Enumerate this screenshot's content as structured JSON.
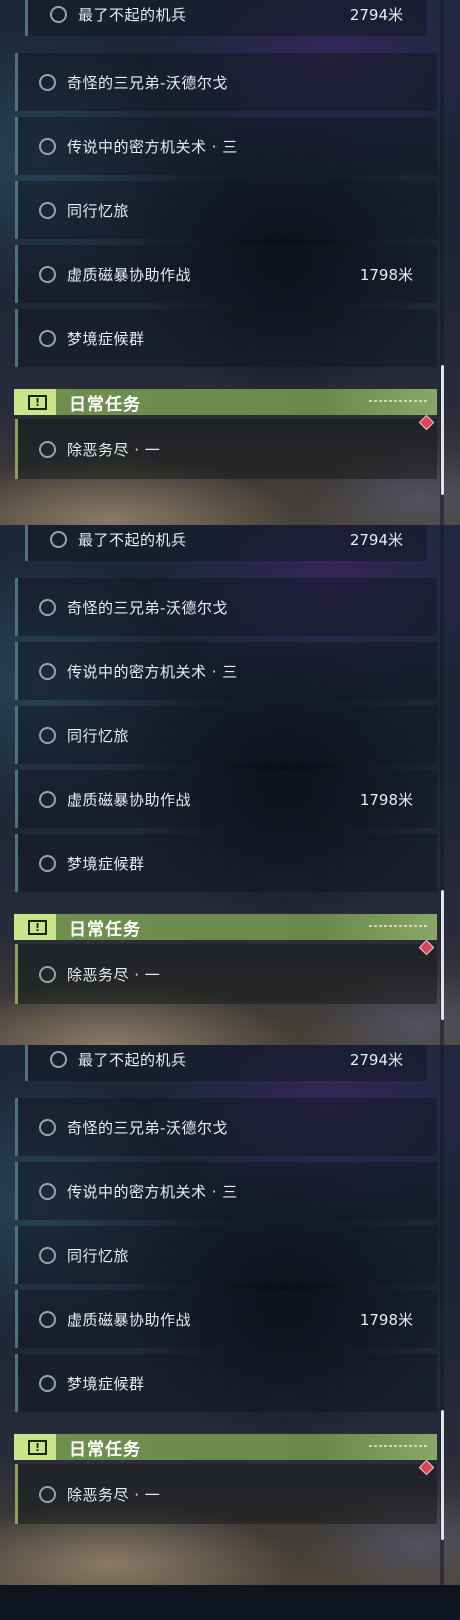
{
  "panels": [
    {
      "quests": [
        {
          "name": "最了不起的机兵",
          "distance": "2794米"
        },
        {
          "name": "奇怪的三兄弟-沃德尔戈",
          "distance": ""
        },
        {
          "name": "传说中的密方机关术 · 三",
          "distance": ""
        },
        {
          "name": "同行忆旅",
          "distance": ""
        },
        {
          "name": "虚质磁暴协助作战",
          "distance": "1798米"
        },
        {
          "name": "梦境症候群",
          "distance": ""
        }
      ],
      "section_title": "日常任务",
      "daily_quest": "除恶务尽 · 一"
    },
    {
      "quests": [
        {
          "name": "最了不起的机兵",
          "distance": "2794米"
        },
        {
          "name": "奇怪的三兄弟-沃德尔戈",
          "distance": ""
        },
        {
          "name": "传说中的密方机关术 · 三",
          "distance": ""
        },
        {
          "name": "同行忆旅",
          "distance": ""
        },
        {
          "name": "虚质磁暴协助作战",
          "distance": "1798米"
        },
        {
          "name": "梦境症候群",
          "distance": ""
        }
      ],
      "section_title": "日常任务",
      "daily_quest": "除恶务尽 · 一"
    },
    {
      "quests": [
        {
          "name": "最了不起的机兵",
          "distance": "2794米"
        },
        {
          "name": "奇怪的三兄弟-沃德尔戈",
          "distance": ""
        },
        {
          "name": "传说中的密方机关术 · 三",
          "distance": ""
        },
        {
          "name": "同行忆旅",
          "distance": ""
        },
        {
          "name": "虚质磁暴协助作战",
          "distance": "1798米"
        },
        {
          "name": "梦境症候群",
          "distance": ""
        }
      ],
      "section_title": "日常任务",
      "daily_quest": "除恶务尽 · 一"
    }
  ],
  "icons": {
    "quest_status": "radio-circle-icon",
    "section": "exclamation-icon",
    "tracking": "diamond-marker-icon"
  },
  "colors": {
    "section_accent": "#c9e58a",
    "section_bar": "#6b8a4c",
    "quest_border": "#4e7284",
    "daily_border": "#8aa05c",
    "marker": "#d8465c"
  }
}
